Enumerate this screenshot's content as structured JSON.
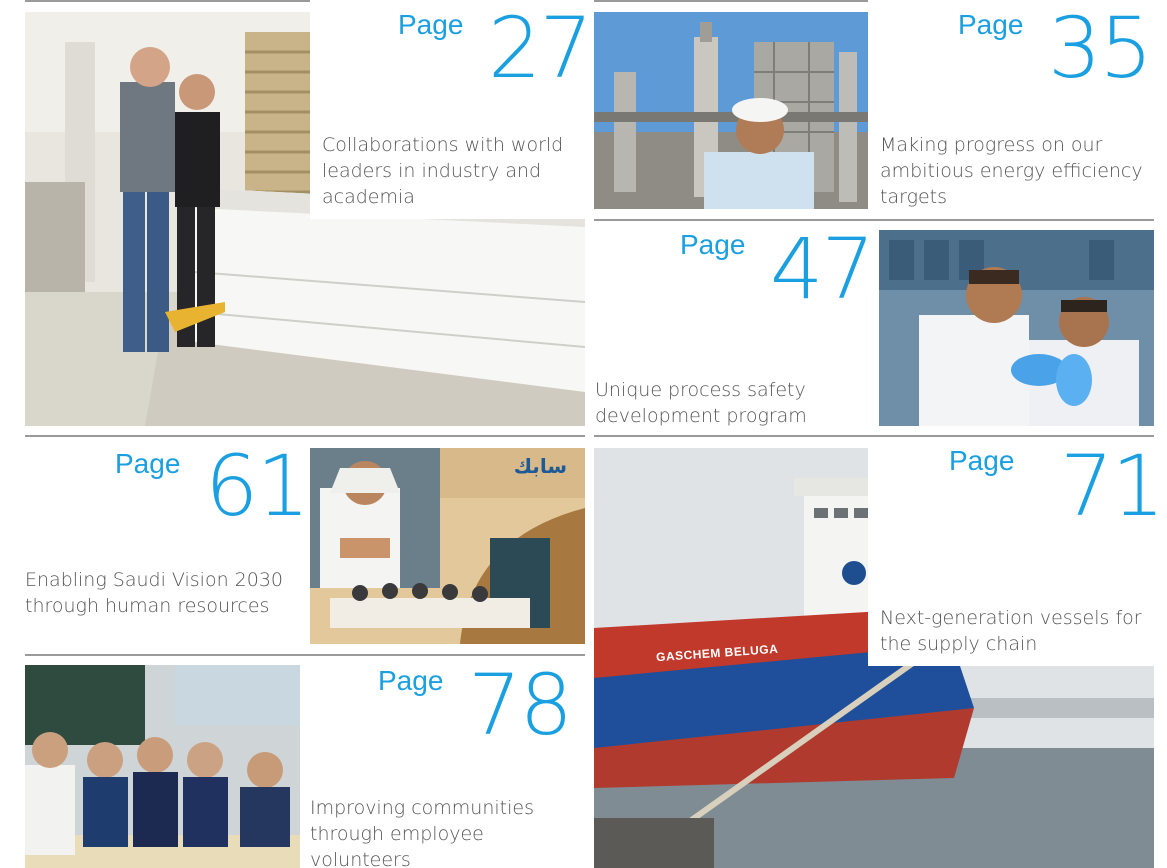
{
  "colors": {
    "accent": "#1a9fe0",
    "caption": "#555555",
    "rule": "#9a9a9a"
  },
  "items": [
    {
      "page_label": "Page",
      "page_number": "27",
      "caption": "Collaborations with world leaders in industry and academia"
    },
    {
      "page_label": "Page",
      "page_number": "35",
      "caption": "Making progress on our ambitious energy efficiency targets"
    },
    {
      "page_label": "Page",
      "page_number": "47",
      "caption": "Unique process safety development program"
    },
    {
      "page_label": "Page",
      "page_number": "61",
      "caption": "Enabling Saudi Vision 2030 through human resources"
    },
    {
      "page_label": "Page",
      "page_number": "71",
      "caption": "Next-generation vessels for the supply chain"
    },
    {
      "page_label": "Page",
      "page_number": "78",
      "caption": "Improving communities through employee volunteers"
    }
  ],
  "photos": {
    "conference_logo_text": "سابك",
    "ship_name": "GASCHEM BELUGA"
  }
}
